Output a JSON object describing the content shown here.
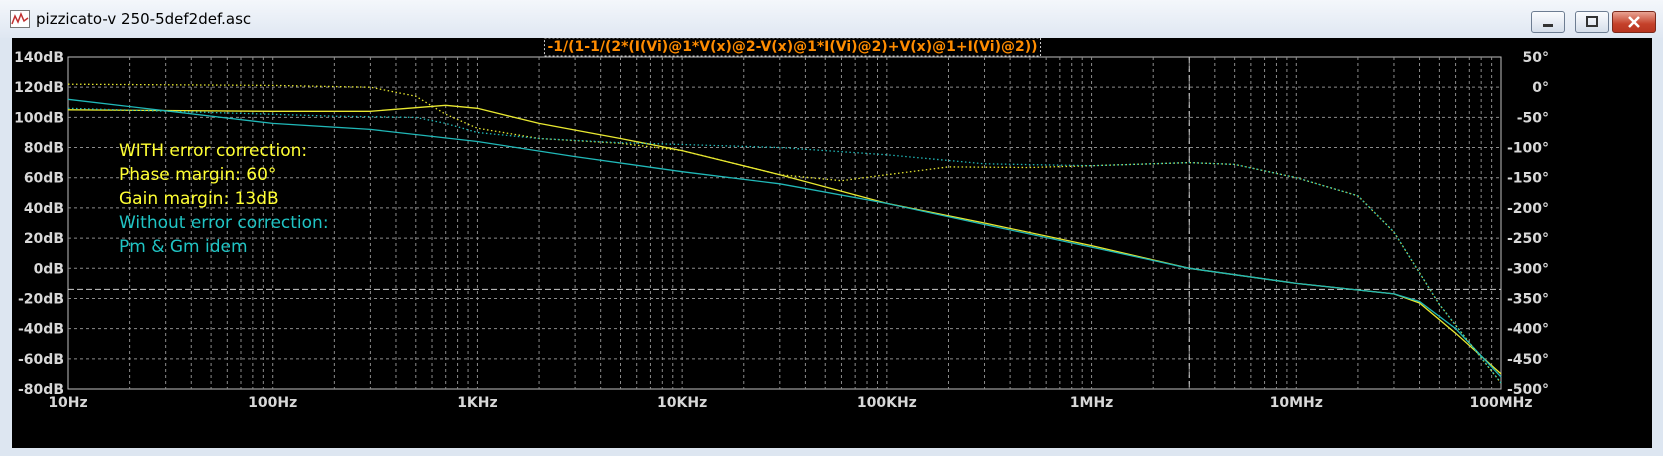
{
  "window": {
    "title": "pizzicato-v 250-5def2def.asc"
  },
  "chart_data": {
    "type": "line",
    "title": "-1/(1-1/(2*(I(Vi)@1*V(x)@2-V(x)@1*I(Vi)@2)+V(x)@1+I(Vi)@2))",
    "xscale": "log",
    "xlim": [
      10,
      100000000
    ],
    "ylim_left": [
      -80,
      140
    ],
    "ylim_right": [
      -500,
      50
    ],
    "grid": "on, dashed",
    "x_ticks": [
      "10Hz",
      "100Hz",
      "1KHz",
      "10KHz",
      "100KHz",
      "1MHz",
      "10MHz",
      "100MHz"
    ],
    "y_left_ticks": [
      "140dB",
      "120dB",
      "100dB",
      "80dB",
      "60dB",
      "40dB",
      "20dB",
      "0dB",
      "-20dB",
      "-40dB",
      "-60dB",
      "-80dB"
    ],
    "y_right_ticks": [
      "50°",
      "0°",
      "-50°",
      "-100°",
      "-150°",
      "-200°",
      "-250°",
      "-300°",
      "-350°",
      "-400°",
      "-450°",
      "-500°"
    ],
    "annotations": [
      {
        "text": "WITH error correction:",
        "color": "#ffff33"
      },
      {
        "text": "Phase margin: 60°",
        "color": "#ffff33"
      },
      {
        "text": "Gain margin: 13dB",
        "color": "#ffff33"
      },
      {
        "text": "Without error correction:",
        "color": "#20c4c4"
      },
      {
        "text": "Pm & Gm idem",
        "color": "#20c4c4"
      }
    ],
    "series": [
      {
        "axis": "left",
        "style": "solid",
        "color": "#e8e830",
        "x": [
          10,
          100,
          300,
          700,
          1000,
          2000,
          5000,
          10000,
          30000,
          100000,
          300000,
          1000000,
          3000000,
          10000000,
          30000000,
          40000000,
          60000000,
          100000000
        ],
        "y": [
          105,
          104,
          104,
          108,
          106,
          96,
          86,
          78,
          62,
          43,
          30,
          15,
          0,
          -10,
          -17,
          -23,
          -43,
          -70
        ]
      },
      {
        "axis": "left",
        "style": "solid",
        "color": "#20b8b8",
        "x": [
          10,
          100,
          300,
          1000,
          3000,
          10000,
          30000,
          100000,
          300000,
          1000000,
          3000000,
          10000000,
          30000000,
          40000000,
          60000000,
          100000000
        ],
        "y": [
          112,
          96,
          92,
          84,
          74,
          64,
          56,
          43,
          29,
          14,
          0,
          -10,
          -17,
          -22,
          -40,
          -72
        ]
      },
      {
        "axis": "right",
        "style": "dotted",
        "color": "#e8e830",
        "x": [
          10,
          100,
          300,
          500,
          700,
          1000,
          2000,
          5000,
          10000,
          30000,
          60000,
          100000,
          200000,
          500000,
          1000000,
          3000000,
          5000000,
          10000000,
          20000000,
          30000000,
          50000000,
          100000000
        ],
        "y": [
          5,
          3,
          0,
          -15,
          -45,
          -68,
          -85,
          -93,
          -105,
          -145,
          -155,
          -145,
          -132,
          -133,
          -130,
          -125,
          -128,
          -150,
          -180,
          -240,
          -360,
          -490
        ]
      },
      {
        "axis": "right",
        "style": "dotted",
        "color": "#20b8b8",
        "x": [
          10,
          100,
          200,
          500,
          700,
          1000,
          2000,
          5000,
          10000,
          30000,
          100000,
          300000,
          1000000,
          3000000,
          5000000,
          10000000,
          20000000,
          30000000,
          50000000,
          100000000
        ],
        "y": [
          -35,
          -45,
          -48,
          -50,
          -60,
          -75,
          -85,
          -92,
          -95,
          -100,
          -112,
          -127,
          -130,
          -125,
          -128,
          -150,
          -180,
          -240,
          -360,
          -490
        ]
      }
    ],
    "reference_line": {
      "axis": "right",
      "y": -335,
      "style": "dashed",
      "color": "#cccccc"
    },
    "cursor_line": {
      "x": 3000000,
      "style": "dashed",
      "color": "#cccccc"
    }
  }
}
